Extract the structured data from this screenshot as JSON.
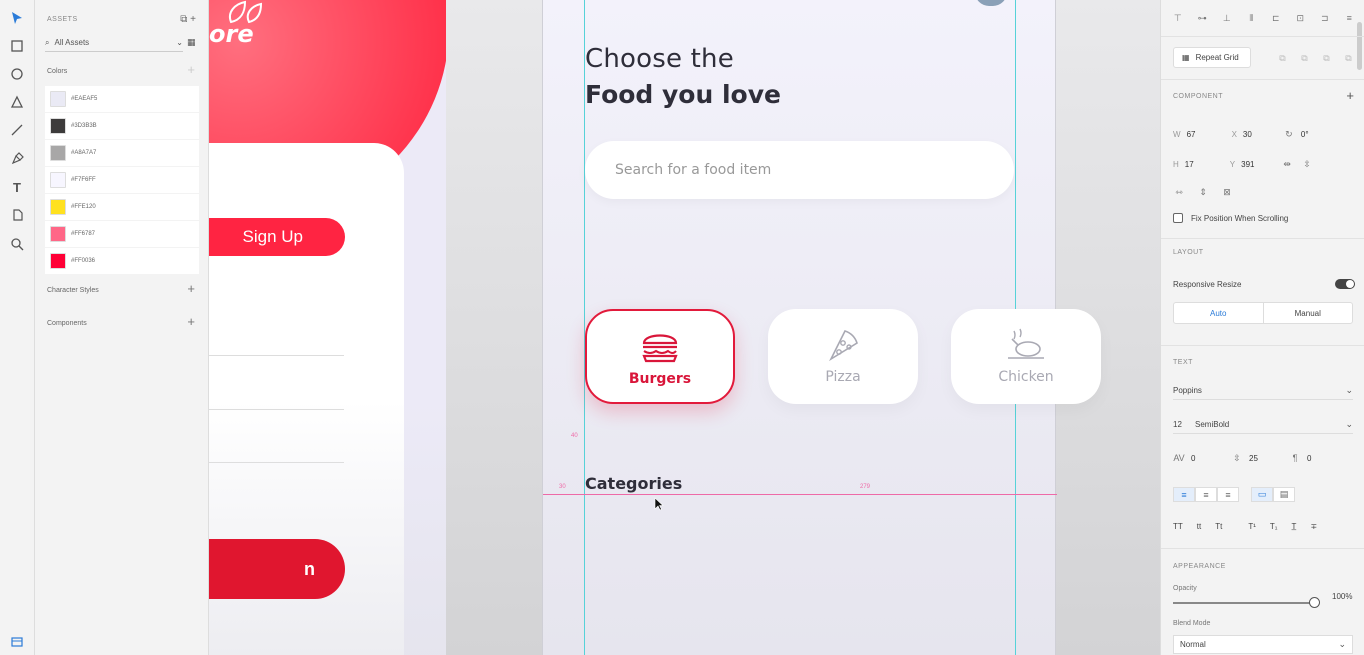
{
  "assets": {
    "header": "ASSETS",
    "search_label": "All Assets",
    "colors_label": "Colors",
    "colors": [
      {
        "hex": "#EAEAF5",
        "label": "#EAEAF5"
      },
      {
        "hex": "#3D3B3B",
        "label": "#3D3B3B"
      },
      {
        "hex": "#A8A7A7",
        "label": "#A8A7A7"
      },
      {
        "hex": "#F7F6FF",
        "label": "#F7F6FF"
      },
      {
        "hex": "#FFE120",
        "label": "#FFE120"
      },
      {
        "hex": "#FF6787",
        "label": "#FF6787"
      },
      {
        "hex": "#FF0036",
        "label": "#FF0036"
      }
    ],
    "character_styles_label": "Character Styles",
    "components_label": "Components"
  },
  "artboard1": {
    "logo_text": "ore",
    "signup_label": "Sign Up",
    "bottom_button_label": "n"
  },
  "artboard2": {
    "heading_line1": "Choose the",
    "heading_line2": "Food you love",
    "search_placeholder": "Search for a food item",
    "categories": [
      {
        "label": "Burgers",
        "icon": "burger-icon",
        "active": true
      },
      {
        "label": "Pizza",
        "icon": "pizza-icon",
        "active": false
      },
      {
        "label": "Chicken",
        "icon": "chicken-icon",
        "active": false
      }
    ],
    "categories_title": "Categories",
    "measure_top": "40",
    "measure_left": "30",
    "measure_right": "279"
  },
  "props": {
    "repeat_grid_label": "Repeat Grid",
    "component_label": "COMPONENT",
    "w_label": "W",
    "w_value": "67",
    "x_label": "X",
    "x_value": "30",
    "h_label": "H",
    "h_value": "17",
    "y_label": "Y",
    "y_value": "391",
    "rotation_value": "0°",
    "fix_position_label": "Fix Position When Scrolling",
    "layout_label": "LAYOUT",
    "responsive_resize_label": "Responsive Resize",
    "auto_label": "Auto",
    "manual_label": "Manual",
    "text_label": "TEXT",
    "font_family": "Poppins",
    "font_size": "12",
    "font_weight": "SemiBold",
    "char_spacing": "0",
    "line_spacing": "25",
    "para_spacing": "0",
    "appearance_label": "APPEARANCE",
    "opacity_label": "Opacity",
    "opacity_value": "100%",
    "blend_mode_label": "Blend Mode",
    "blend_mode_value": "Normal",
    "case_options": [
      "TT",
      "tt",
      "Tt"
    ]
  }
}
